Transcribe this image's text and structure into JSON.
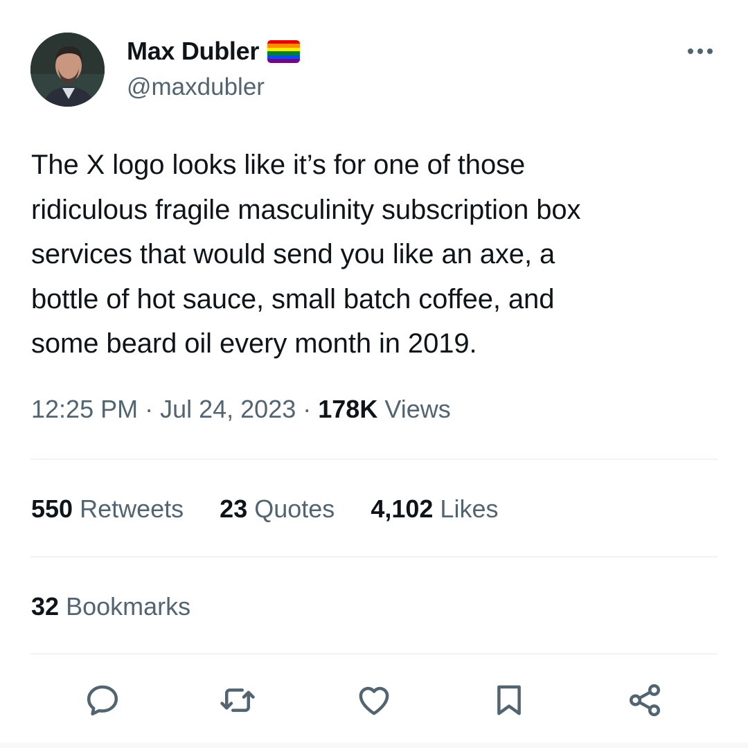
{
  "author": {
    "display_name": "Max Dubler",
    "handle": "@maxdubler",
    "badge_icon": "rainbow-flag-icon",
    "flag_colors": [
      "#e40303",
      "#ff8c00",
      "#ffed00",
      "#008026",
      "#004dff",
      "#750787"
    ]
  },
  "tweet": {
    "text_lines": [
      "The X logo looks like it’s for one of those",
      "ridiculous fragile masculinity subscription box",
      "services that would send you like an axe, a",
      "bottle of hot sauce, small batch coffee, and",
      "some beard oil every month in 2019."
    ]
  },
  "meta": {
    "time": "12:25 PM",
    "separator": " · ",
    "date": "Jul 24, 2023",
    "views_count": "178K",
    "views_label": "Views"
  },
  "stats": {
    "retweets_count": "550",
    "retweets_label": "Retweets",
    "quotes_count": "23",
    "quotes_label": "Quotes",
    "likes_count": "4,102",
    "likes_label": "Likes",
    "bookmarks_count": "32",
    "bookmarks_label": "Bookmarks"
  },
  "actions": {
    "reply_icon": "reply-icon",
    "retweet_icon": "retweet-icon",
    "like_icon": "heart-icon",
    "bookmark_icon": "bookmark-icon",
    "share_icon": "share-icon"
  },
  "colors": {
    "text_primary": "#0f1419",
    "text_secondary": "#536471",
    "divider": "#eff3f4"
  }
}
